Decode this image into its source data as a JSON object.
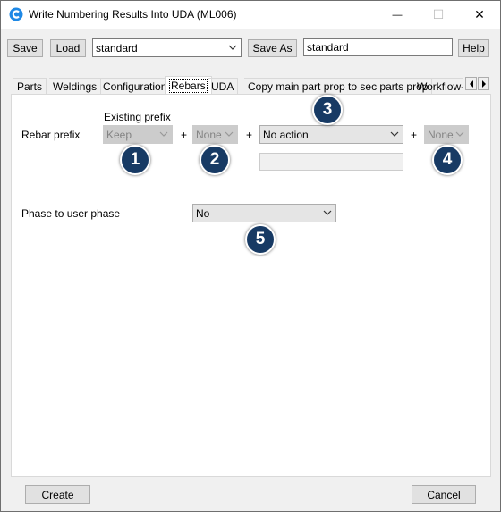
{
  "window": {
    "title": "Write Numbering Results Into UDA (ML006)",
    "minimize_glyph": "—",
    "maximize_glyph": "☐",
    "close_glyph": "✕"
  },
  "toolbar": {
    "save_label": "Save",
    "load_label": "Load",
    "settings_value": "standard",
    "save_as_label": "Save As",
    "save_as_value": "standard",
    "help_label": "Help"
  },
  "tabs": [
    {
      "label": "Parts"
    },
    {
      "label": "Weldings"
    },
    {
      "label": "Configuration"
    },
    {
      "label": "Rebars",
      "active": true
    },
    {
      "label": "UDA"
    },
    {
      "label": "Copy main part prop to sec parts prop"
    },
    {
      "label": "Workflow-s"
    }
  ],
  "rebars": {
    "rebar_prefix_label": "Rebar prefix",
    "existing_prefix_label": "Existing prefix",
    "existing_prefix_value": "Keep",
    "plus": "+",
    "second_value": "None",
    "action_value": "No action",
    "action_text": "",
    "fourth_value": "None",
    "phase_label": "Phase to user phase",
    "phase_value": "No"
  },
  "badges": [
    "1",
    "2",
    "3",
    "4",
    "5"
  ],
  "footer": {
    "create_label": "Create",
    "cancel_label": "Cancel"
  },
  "colors": {
    "badge_fill": "#173a64",
    "app_icon": "#1e88e5",
    "window_bg": "#f0f0f0"
  }
}
